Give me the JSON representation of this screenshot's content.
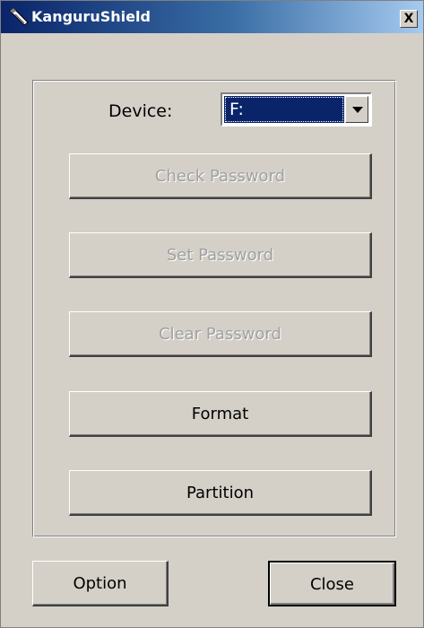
{
  "window": {
    "title": "KanguruShield",
    "close_glyph": "X"
  },
  "device": {
    "label": "Device:",
    "selected": "F:"
  },
  "buttons": {
    "check_password": "Check Password",
    "set_password": "Set Password",
    "clear_password": "Clear Password",
    "format": "Format",
    "partition": "Partition",
    "option": "Option",
    "close": "Close"
  },
  "icons": {
    "app": "usb-drive-icon",
    "dropdown": "chevron-down-icon"
  },
  "colors": {
    "title_start": "#0a246a",
    "title_end": "#a6caf0",
    "face": "#d4d0c8",
    "selection": "#0a246a",
    "disabled_text": "#a0a0a0"
  }
}
